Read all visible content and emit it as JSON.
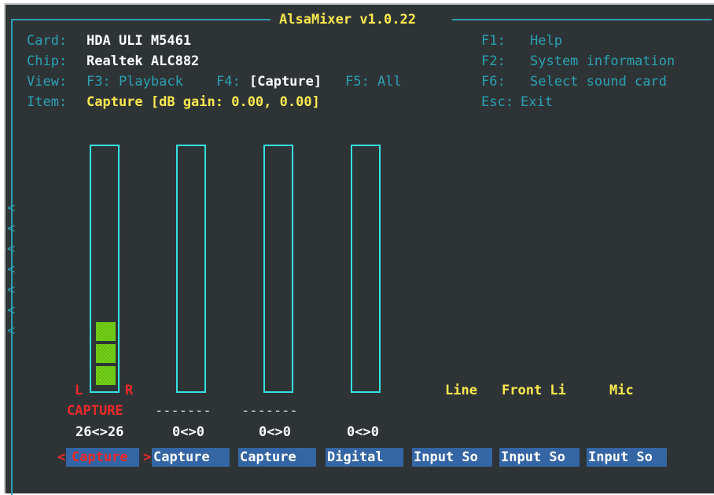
{
  "window": {
    "title": "AlsaMixer v1.0.22"
  },
  "info": {
    "card_label": "Card:",
    "card_value": "HDA ULI M5461",
    "chip_label": "Chip:",
    "chip_value": "Realtek ALC882",
    "view_label": "View:",
    "view_f3": "F3: Playback",
    "view_f4_key": "F4:",
    "view_f4_value": "[Capture]",
    "view_f5": "F5: All",
    "item_label": "Item:",
    "item_value": "Capture [dB gain: 0.00, 0.00]"
  },
  "keys": [
    {
      "key": "F1:",
      "label": "Help"
    },
    {
      "key": "F2:",
      "label": "System information"
    },
    {
      "key": "F6:",
      "label": "Select sound card"
    },
    {
      "key": "Esc:",
      "label": "Exit"
    }
  ],
  "left_arrow": "<",
  "controls": [
    {
      "name": "Capture",
      "level_fraction": 0.26,
      "lr_left": "L",
      "lr_right": "R",
      "switch": "CAPTURE",
      "value": "26<>26",
      "selected": true
    },
    {
      "name": "Capture",
      "level_fraction": 0.0,
      "switch": "-------",
      "value": "0<>0",
      "selected": false
    },
    {
      "name": "Capture",
      "level_fraction": 0.0,
      "switch": "-------",
      "value": "0<>0",
      "selected": false
    },
    {
      "name": "Digital",
      "level_fraction": 0.0,
      "value": "0<>0",
      "selected": false
    },
    {
      "name": "Input So",
      "label": "Line",
      "selected": false
    },
    {
      "name": "Input So",
      "label": "Front Li",
      "selected": false
    },
    {
      "name": "Input So",
      "label": "Mic",
      "selected": false
    }
  ],
  "colors": {
    "background": "#2e3436",
    "frame": "#2aa1b3",
    "bar_border": "#34e2e2",
    "level": "#73d216",
    "tab_bg": "#3465a4",
    "highlight": "#ef2929",
    "value": "#fce94f"
  },
  "icons": {
    "scroll_left": "left-chevron-icon"
  }
}
